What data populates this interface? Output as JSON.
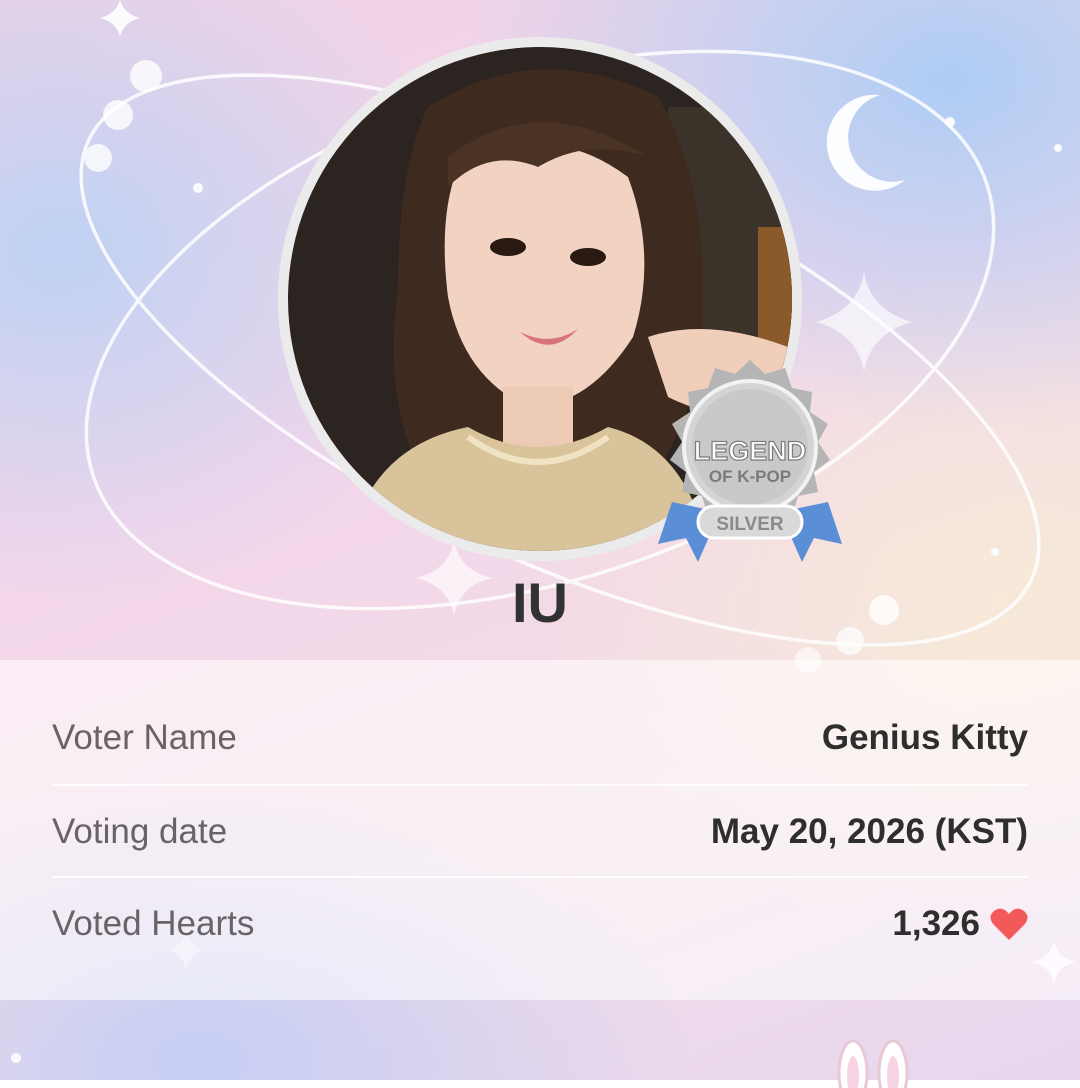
{
  "artist": {
    "name": "IU",
    "badge": {
      "line1": "LEGEND",
      "line2": "OF K-POP",
      "tier": "SILVER"
    }
  },
  "vote_info": {
    "rows": [
      {
        "label": "Voter Name",
        "value": "Genius Kitty"
      },
      {
        "label": "Voting date",
        "value": "May 20, 2026 (KST)"
      },
      {
        "label": "Voted Hearts",
        "value": "1,326"
      }
    ]
  },
  "colors": {
    "heart": "#f25a5a",
    "badge_ribbon": "#5a8fd8",
    "badge_silver": "#c9c9c9"
  },
  "icons": [
    "heart-icon",
    "moon-icon",
    "sparkle-icon",
    "bunny-icon"
  ]
}
